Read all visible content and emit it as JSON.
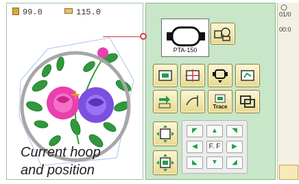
{
  "readouts": {
    "height_value": "99.0",
    "width_value": "115.0",
    "height_icon": "height-icon",
    "width_icon": "width-icon"
  },
  "caption": {
    "line1": "Current hoop",
    "line2": "and position"
  },
  "hoop": {
    "label": "PTA-150"
  },
  "arrow_pad": {
    "center_label": "F. F"
  },
  "buttons": {
    "trace_label": "Trace"
  },
  "right_panel": {
    "date": "01/0",
    "time": "00:0"
  },
  "colors": {
    "panel_green": "#c8e6c8",
    "button_yellow": "#f3e7a6",
    "hoop_ring": "#a7a7a7",
    "arrow_green": "#1fa04a",
    "connector_red": "#d23a3a"
  }
}
